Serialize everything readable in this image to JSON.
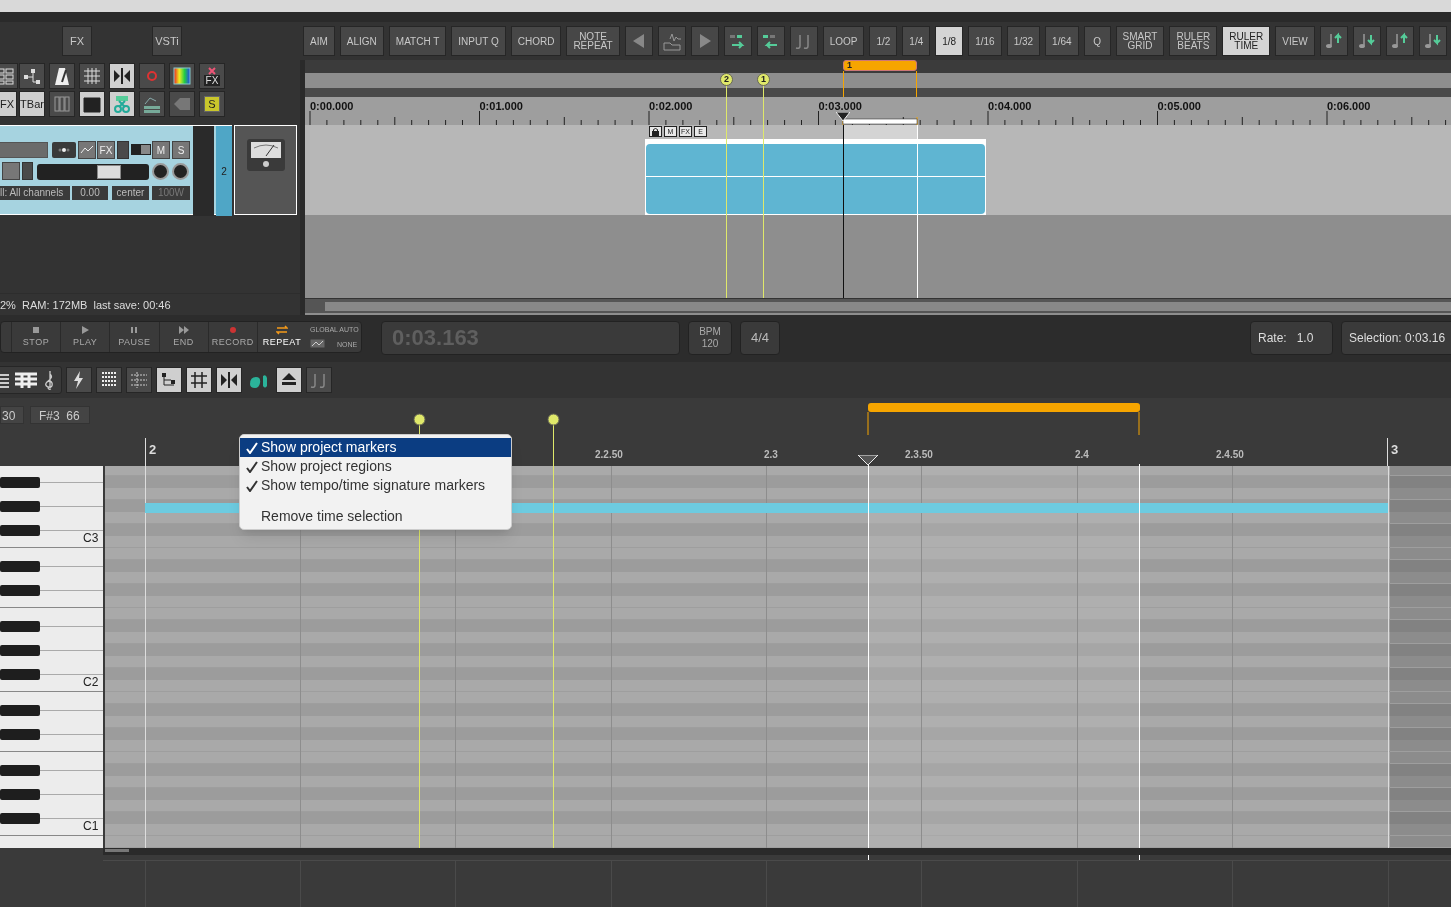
{
  "main_toolbar": {
    "left_buttons": [
      {
        "label": "FX"
      },
      {
        "label": "VSTi"
      }
    ],
    "buttons_a": [
      {
        "label": "AIM",
        "selected": false
      },
      {
        "label": "ALIGN",
        "selected": false
      },
      {
        "label": "MATCH T",
        "selected": false
      },
      {
        "label": "INPUT Q",
        "selected": false
      },
      {
        "label": "CHORD",
        "selected": false
      },
      {
        "label": "NOTE\nREPEAT",
        "selected": false
      }
    ],
    "buttons_b": [
      {
        "label": "LOOP",
        "selected": false
      },
      {
        "label": "1/2",
        "selected": false
      },
      {
        "label": "1/4",
        "selected": false
      },
      {
        "label": "1/8",
        "selected": true
      },
      {
        "label": "1/16",
        "selected": false
      },
      {
        "label": "1/32",
        "selected": false
      },
      {
        "label": "1/64",
        "selected": false
      },
      {
        "label": "Q",
        "selected": false
      },
      {
        "label": "SMART\nGRID",
        "selected": false
      },
      {
        "label": "RULER\nBEATS",
        "selected": false
      },
      {
        "label": "RULER\nTIME",
        "selected": true
      },
      {
        "label": "VIEW",
        "selected": false
      }
    ]
  },
  "left_toolbar": {
    "text_buttons": [
      "FX",
      "FX",
      "TBar",
      "S"
    ]
  },
  "track": {
    "number": "2",
    "switch_on": true,
    "input": "ll: All channels",
    "volume": "0.00",
    "pan": "center",
    "width": "100W",
    "buttons": [
      "FX",
      "M",
      "S"
    ]
  },
  "status_bar": "2%  RAM: 172MB  last save: 00:46",
  "arrange": {
    "ruler": [
      "0:00.000",
      "0:01.000",
      "0:02.000",
      "0:03.000",
      "0:04.000",
      "0:05.000",
      "0:06.000"
    ],
    "markers": [
      {
        "label": "2"
      },
      {
        "label": "1"
      }
    ],
    "region": {
      "label": "1"
    },
    "item_buttons": [
      "M",
      "FX",
      "E"
    ]
  },
  "transport": {
    "buttons": [
      {
        "label": "STOP",
        "selected": false
      },
      {
        "label": "PLAY",
        "selected": false
      },
      {
        "label": "PAUSE",
        "selected": false
      },
      {
        "label": "END",
        "selected": false
      },
      {
        "label": "RECORD",
        "selected": false
      },
      {
        "label": "REPEAT",
        "selected": true
      }
    ],
    "global_auto": {
      "label": "GLOBAL AUTO",
      "value": "NONE"
    },
    "time": "0:03.163",
    "bpm_label": "BPM",
    "bpm": "120",
    "signature": "4/4",
    "rate_label": "Rate:",
    "rate": "1.0",
    "selection": "Selection: 0:03.16"
  },
  "piano_roll": {
    "info": [
      "30",
      "F#3  66"
    ],
    "ruler": [
      {
        "label": "2",
        "kind": "bar"
      },
      {
        "label": "2.2.50",
        "kind": "sub"
      },
      {
        "label": "2.3",
        "kind": "sub"
      },
      {
        "label": "2.3.50",
        "kind": "sub"
      },
      {
        "label": "2.4",
        "kind": "sub"
      },
      {
        "label": "2.4.50",
        "kind": "sub"
      },
      {
        "label": "3",
        "kind": "bar"
      }
    ],
    "key_labels": [
      "C3",
      "C2",
      "C1"
    ]
  },
  "context_menu": {
    "items": [
      {
        "label": "Show project markers",
        "checked": true,
        "selected": true
      },
      {
        "label": "Show project regions",
        "checked": true,
        "selected": false
      },
      {
        "label": "Show tempo/time signature markers",
        "checked": true,
        "selected": false
      },
      {
        "label": "Remove time selection",
        "checked": false,
        "selected": false,
        "separator_before": true
      }
    ]
  }
}
